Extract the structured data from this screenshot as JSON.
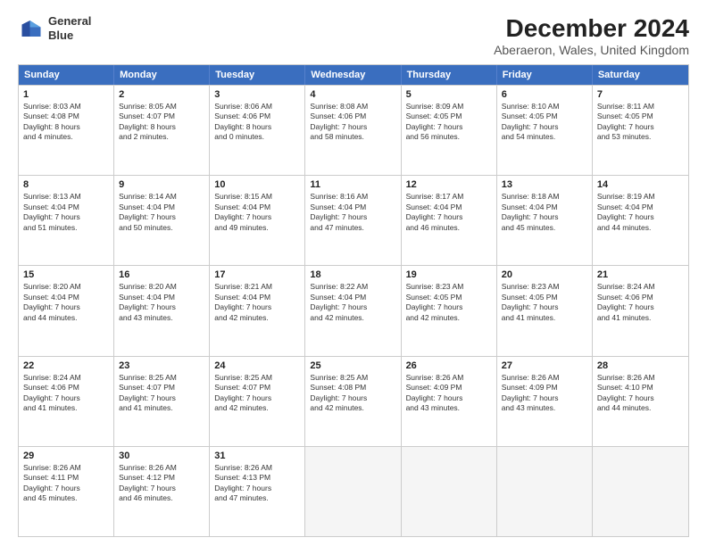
{
  "header": {
    "logo_line1": "General",
    "logo_line2": "Blue",
    "main_title": "December 2024",
    "subtitle": "Aberaeron, Wales, United Kingdom"
  },
  "calendar": {
    "days_of_week": [
      "Sunday",
      "Monday",
      "Tuesday",
      "Wednesday",
      "Thursday",
      "Friday",
      "Saturday"
    ],
    "rows": [
      [
        {
          "day": "1",
          "text": "Sunrise: 8:03 AM\nSunset: 4:08 PM\nDaylight: 8 hours\nand 4 minutes."
        },
        {
          "day": "2",
          "text": "Sunrise: 8:05 AM\nSunset: 4:07 PM\nDaylight: 8 hours\nand 2 minutes."
        },
        {
          "day": "3",
          "text": "Sunrise: 8:06 AM\nSunset: 4:06 PM\nDaylight: 8 hours\nand 0 minutes."
        },
        {
          "day": "4",
          "text": "Sunrise: 8:08 AM\nSunset: 4:06 PM\nDaylight: 7 hours\nand 58 minutes."
        },
        {
          "day": "5",
          "text": "Sunrise: 8:09 AM\nSunset: 4:05 PM\nDaylight: 7 hours\nand 56 minutes."
        },
        {
          "day": "6",
          "text": "Sunrise: 8:10 AM\nSunset: 4:05 PM\nDaylight: 7 hours\nand 54 minutes."
        },
        {
          "day": "7",
          "text": "Sunrise: 8:11 AM\nSunset: 4:05 PM\nDaylight: 7 hours\nand 53 minutes."
        }
      ],
      [
        {
          "day": "8",
          "text": "Sunrise: 8:13 AM\nSunset: 4:04 PM\nDaylight: 7 hours\nand 51 minutes."
        },
        {
          "day": "9",
          "text": "Sunrise: 8:14 AM\nSunset: 4:04 PM\nDaylight: 7 hours\nand 50 minutes."
        },
        {
          "day": "10",
          "text": "Sunrise: 8:15 AM\nSunset: 4:04 PM\nDaylight: 7 hours\nand 49 minutes."
        },
        {
          "day": "11",
          "text": "Sunrise: 8:16 AM\nSunset: 4:04 PM\nDaylight: 7 hours\nand 47 minutes."
        },
        {
          "day": "12",
          "text": "Sunrise: 8:17 AM\nSunset: 4:04 PM\nDaylight: 7 hours\nand 46 minutes."
        },
        {
          "day": "13",
          "text": "Sunrise: 8:18 AM\nSunset: 4:04 PM\nDaylight: 7 hours\nand 45 minutes."
        },
        {
          "day": "14",
          "text": "Sunrise: 8:19 AM\nSunset: 4:04 PM\nDaylight: 7 hours\nand 44 minutes."
        }
      ],
      [
        {
          "day": "15",
          "text": "Sunrise: 8:20 AM\nSunset: 4:04 PM\nDaylight: 7 hours\nand 44 minutes."
        },
        {
          "day": "16",
          "text": "Sunrise: 8:20 AM\nSunset: 4:04 PM\nDaylight: 7 hours\nand 43 minutes."
        },
        {
          "day": "17",
          "text": "Sunrise: 8:21 AM\nSunset: 4:04 PM\nDaylight: 7 hours\nand 42 minutes."
        },
        {
          "day": "18",
          "text": "Sunrise: 8:22 AM\nSunset: 4:04 PM\nDaylight: 7 hours\nand 42 minutes."
        },
        {
          "day": "19",
          "text": "Sunrise: 8:23 AM\nSunset: 4:05 PM\nDaylight: 7 hours\nand 42 minutes."
        },
        {
          "day": "20",
          "text": "Sunrise: 8:23 AM\nSunset: 4:05 PM\nDaylight: 7 hours\nand 41 minutes."
        },
        {
          "day": "21",
          "text": "Sunrise: 8:24 AM\nSunset: 4:06 PM\nDaylight: 7 hours\nand 41 minutes."
        }
      ],
      [
        {
          "day": "22",
          "text": "Sunrise: 8:24 AM\nSunset: 4:06 PM\nDaylight: 7 hours\nand 41 minutes."
        },
        {
          "day": "23",
          "text": "Sunrise: 8:25 AM\nSunset: 4:07 PM\nDaylight: 7 hours\nand 41 minutes."
        },
        {
          "day": "24",
          "text": "Sunrise: 8:25 AM\nSunset: 4:07 PM\nDaylight: 7 hours\nand 42 minutes."
        },
        {
          "day": "25",
          "text": "Sunrise: 8:25 AM\nSunset: 4:08 PM\nDaylight: 7 hours\nand 42 minutes."
        },
        {
          "day": "26",
          "text": "Sunrise: 8:26 AM\nSunset: 4:09 PM\nDaylight: 7 hours\nand 43 minutes."
        },
        {
          "day": "27",
          "text": "Sunrise: 8:26 AM\nSunset: 4:09 PM\nDaylight: 7 hours\nand 43 minutes."
        },
        {
          "day": "28",
          "text": "Sunrise: 8:26 AM\nSunset: 4:10 PM\nDaylight: 7 hours\nand 44 minutes."
        }
      ],
      [
        {
          "day": "29",
          "text": "Sunrise: 8:26 AM\nSunset: 4:11 PM\nDaylight: 7 hours\nand 45 minutes."
        },
        {
          "day": "30",
          "text": "Sunrise: 8:26 AM\nSunset: 4:12 PM\nDaylight: 7 hours\nand 46 minutes."
        },
        {
          "day": "31",
          "text": "Sunrise: 8:26 AM\nSunset: 4:13 PM\nDaylight: 7 hours\nand 47 minutes."
        },
        {
          "day": "",
          "text": ""
        },
        {
          "day": "",
          "text": ""
        },
        {
          "day": "",
          "text": ""
        },
        {
          "day": "",
          "text": ""
        }
      ]
    ]
  }
}
